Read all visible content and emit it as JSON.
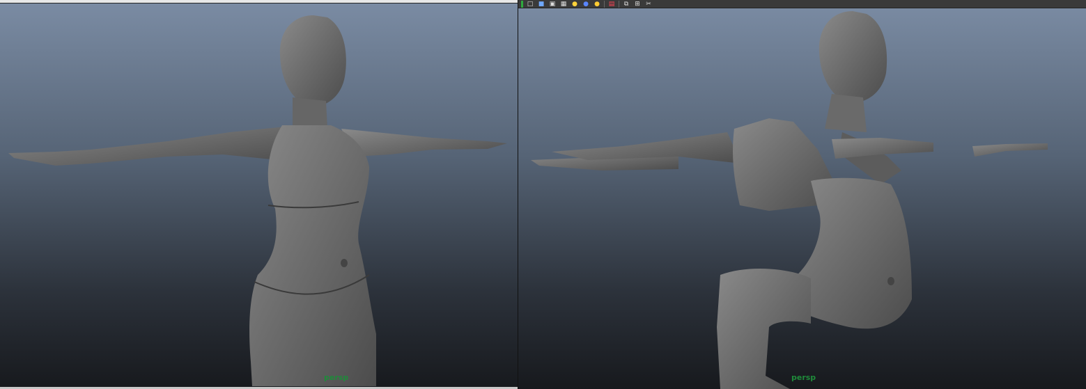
{
  "left_viewport": {
    "camera_label": "persp"
  },
  "right_viewport": {
    "camera_label": "persp",
    "toolbar_icons": [
      "left-edge-icon",
      "cube-wire-icon",
      "cube-smooth-icon",
      "cube-shaded-icon",
      "texture-checker-icon",
      "light-default-icon",
      "light-all-icon",
      "light-bulb-icon",
      "isolate-select-icon",
      "camera-icon",
      "grid-icon",
      "settings-icon"
    ]
  },
  "colors": {
    "bg_top": "#7b8ca4",
    "bg_bottom": "#17191d",
    "model_fill": "#6e6e6e",
    "label_green": "#1f8a3a"
  }
}
